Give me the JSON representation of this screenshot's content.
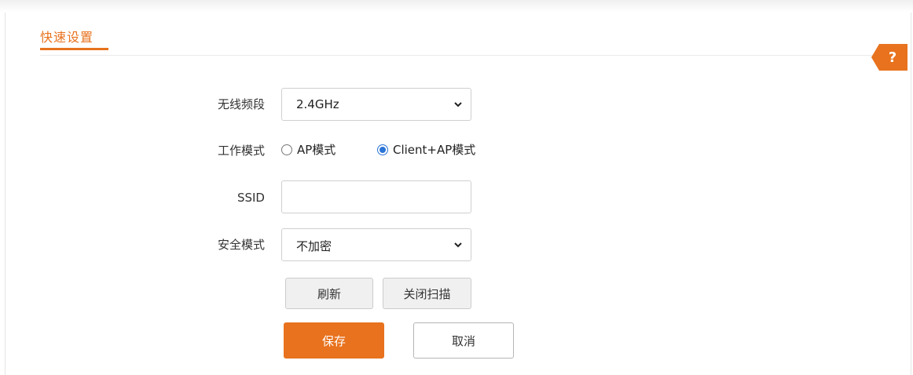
{
  "tab": {
    "title": "快速设置"
  },
  "help": {
    "label": "?"
  },
  "form": {
    "band": {
      "label": "无线频段",
      "value": "2.4GHz"
    },
    "mode": {
      "label": "工作模式",
      "options": [
        {
          "label": "AP模式",
          "checked": false
        },
        {
          "label": "Client+AP模式",
          "checked": true
        }
      ]
    },
    "ssid": {
      "label": "SSID",
      "value": "",
      "placeholder": ""
    },
    "security": {
      "label": "安全模式",
      "value": "不加密"
    }
  },
  "buttons": {
    "refresh": "刷新",
    "close_scan": "关闭扫描",
    "save": "保存",
    "cancel": "取消"
  },
  "colors": {
    "accent": "#e8721d",
    "radio_selected": "#2a74d6"
  }
}
